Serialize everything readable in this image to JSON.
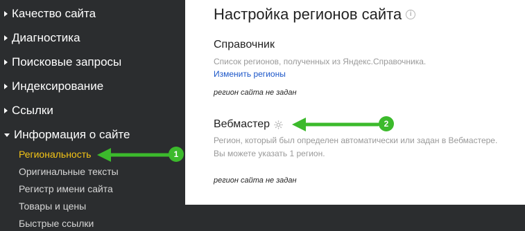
{
  "sidebar": {
    "items": [
      {
        "label": "Качество сайта"
      },
      {
        "label": "Диагностика"
      },
      {
        "label": "Поисковые запросы"
      },
      {
        "label": "Индексирование"
      },
      {
        "label": "Ссылки"
      },
      {
        "label": "Информация о сайте"
      }
    ],
    "subitems": [
      {
        "label": "Региональность",
        "active": true
      },
      {
        "label": "Оригинальные тексты"
      },
      {
        "label": "Регистр имени сайта"
      },
      {
        "label": "Товары и цены"
      },
      {
        "label": "Быстрые ссылки"
      }
    ]
  },
  "main": {
    "title": "Настройка регионов сайта",
    "info_icon": "i",
    "directory": {
      "title": "Справочник",
      "description": "Список регионов, полученных из Яндекс.Справочника.",
      "link": "Изменить регионы",
      "status": "регион сайта не задан"
    },
    "webmaster": {
      "title": "Вебмастер",
      "description_line1": "Регион, который был определен автоматически или задан в Вебмастере.",
      "description_line2": "Вы можете указать 1 регион.",
      "status": "регион сайта не задан"
    }
  },
  "annotations": {
    "badge1": "1",
    "badge2": "2",
    "color": "#3cba2c"
  }
}
